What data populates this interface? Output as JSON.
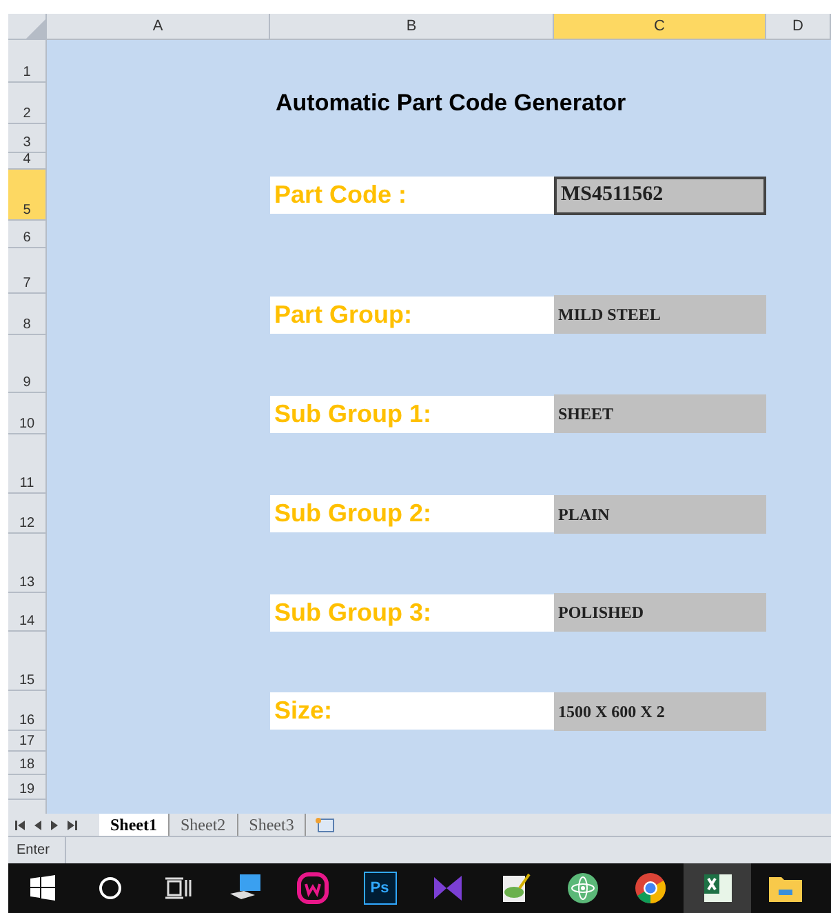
{
  "columns": [
    {
      "label": "A",
      "selected": false
    },
    {
      "label": "B",
      "selected": false
    },
    {
      "label": "C",
      "selected": true
    },
    {
      "label": "D",
      "selected": false
    }
  ],
  "rows": [
    {
      "number": "1",
      "selected": false
    },
    {
      "number": "2",
      "selected": false,
      "kind": "title",
      "text": "Automatic Part Code Generator"
    },
    {
      "number": "3",
      "selected": false
    },
    {
      "number": "4",
      "selected": false
    },
    {
      "number": "5",
      "selected": true,
      "kind": "field",
      "label": "Part Code :",
      "value": "MS4511562",
      "active": true
    },
    {
      "number": "6",
      "selected": false
    },
    {
      "number": "7",
      "selected": false
    },
    {
      "number": "8",
      "selected": false,
      "kind": "field",
      "label": "Part Group:",
      "value": "MILD STEEL",
      "active": false
    },
    {
      "number": "9",
      "selected": false
    },
    {
      "number": "10",
      "selected": false,
      "kind": "field",
      "label": "Sub Group 1:",
      "value": "SHEET",
      "active": false
    },
    {
      "number": "11",
      "selected": false
    },
    {
      "number": "12",
      "selected": false,
      "kind": "field",
      "label": "Sub Group 2:",
      "value": "PLAIN",
      "active": false
    },
    {
      "number": "13",
      "selected": false
    },
    {
      "number": "14",
      "selected": false,
      "kind": "field",
      "label": "Sub Group 3:",
      "value": "POLISHED",
      "active": false
    },
    {
      "number": "15",
      "selected": false
    },
    {
      "number": "16",
      "selected": false,
      "kind": "field",
      "label": "Size:",
      "value": "1500 X 600 X 2",
      "active": false
    },
    {
      "number": "17",
      "selected": false
    },
    {
      "number": "18",
      "selected": false
    },
    {
      "number": "19",
      "selected": false
    }
  ],
  "sheet_tabs": [
    {
      "label": "Sheet1",
      "selected": true
    },
    {
      "label": "Sheet2",
      "selected": false
    },
    {
      "label": "Sheet3",
      "selected": false
    }
  ],
  "status_bar": "Enter",
  "taskbar": [
    {
      "kind": "windows",
      "active": false
    },
    {
      "kind": "search",
      "active": false
    },
    {
      "kind": "taskview",
      "active": false
    },
    {
      "kind": "computer",
      "active": false
    },
    {
      "kind": "wamp",
      "active": false
    },
    {
      "kind": "ps",
      "text": "Ps",
      "active": false
    },
    {
      "kind": "vs",
      "active": false
    },
    {
      "kind": "notepad",
      "active": false
    },
    {
      "kind": "atom",
      "active": false
    },
    {
      "kind": "chrome",
      "active": false
    },
    {
      "kind": "excel",
      "active": true
    },
    {
      "kind": "folder",
      "active": false
    }
  ]
}
